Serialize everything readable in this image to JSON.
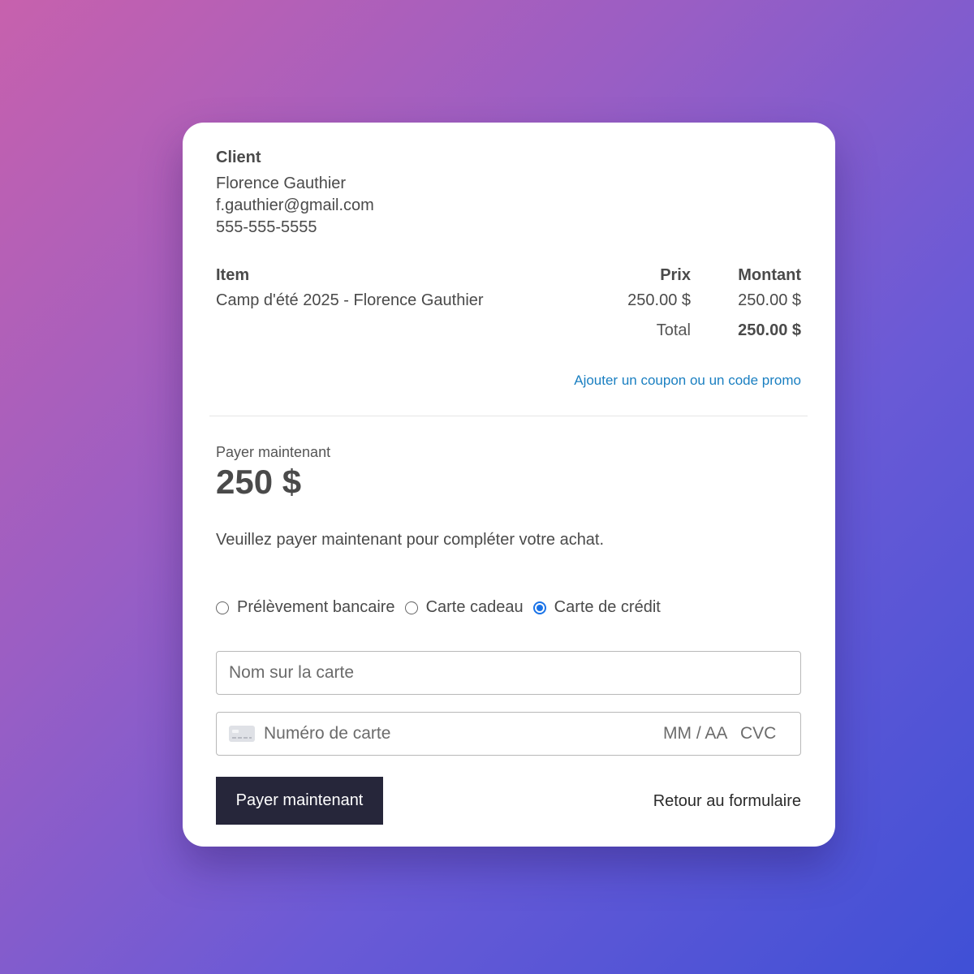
{
  "client": {
    "heading": "Client",
    "name": "Florence Gauthier",
    "email": "f.gauthier@gmail.com",
    "phone": "555-555-5555"
  },
  "items_table": {
    "headers": {
      "item": "Item",
      "price": "Prix",
      "amount": "Montant"
    },
    "rows": [
      {
        "item": "Camp d'été 2025 - Florence Gauthier",
        "price": "250.00 $",
        "amount": "250.00 $"
      }
    ],
    "total_label": "Total",
    "total_value": "250.00 $"
  },
  "coupon_link": "Ajouter un coupon ou un code promo",
  "payment": {
    "label": "Payer maintenant",
    "amount": "250 $",
    "instructions": "Veuillez payer maintenant pour compléter votre achat.",
    "methods": [
      {
        "label": "Prélèvement bancaire",
        "selected": false
      },
      {
        "label": "Carte cadeau",
        "selected": false
      },
      {
        "label": "Carte de crédit",
        "selected": true
      }
    ],
    "name_on_card_placeholder": "Nom sur la carte",
    "card_number_placeholder": "Numéro de carte",
    "expiry_placeholder": "MM / AA",
    "cvc_placeholder": "CVC",
    "accent_color": "#1a73e8"
  },
  "actions": {
    "pay_button": "Payer maintenant",
    "back_link": "Retour au formulaire"
  },
  "colors": {
    "button_bg": "#26263a",
    "link": "#1a7fc1"
  }
}
